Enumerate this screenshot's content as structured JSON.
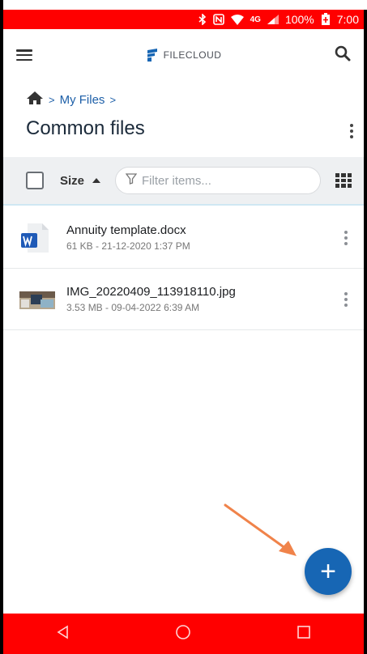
{
  "status_bar": {
    "network": "4G",
    "battery": "100%",
    "time": "7:00"
  },
  "app": {
    "logo_text": "FILECLOUD"
  },
  "breadcrumb": {
    "items": [
      {
        "label": "My Files"
      }
    ],
    "separator": ">"
  },
  "page": {
    "title": "Common files"
  },
  "toolbar": {
    "sort_label": "Size",
    "filter_placeholder": "Filter items..."
  },
  "files": [
    {
      "name": "Annuity template.docx",
      "meta": "61 KB - 21-12-2020 1:37 PM",
      "icon": "word-document-icon"
    },
    {
      "name": "IMG_20220409_113918110.jpg",
      "meta": "3.53 MB - 09-04-2022 6:39 AM",
      "icon": "image-thumbnail"
    }
  ],
  "fab": {
    "label": "+"
  },
  "colors": {
    "status_bar_bg": "#ff0000",
    "nav_bar_bg": "#ff0000",
    "accent": "#1766b4",
    "link": "#1d5fa8",
    "annotation_arrow": "#f0834a"
  }
}
